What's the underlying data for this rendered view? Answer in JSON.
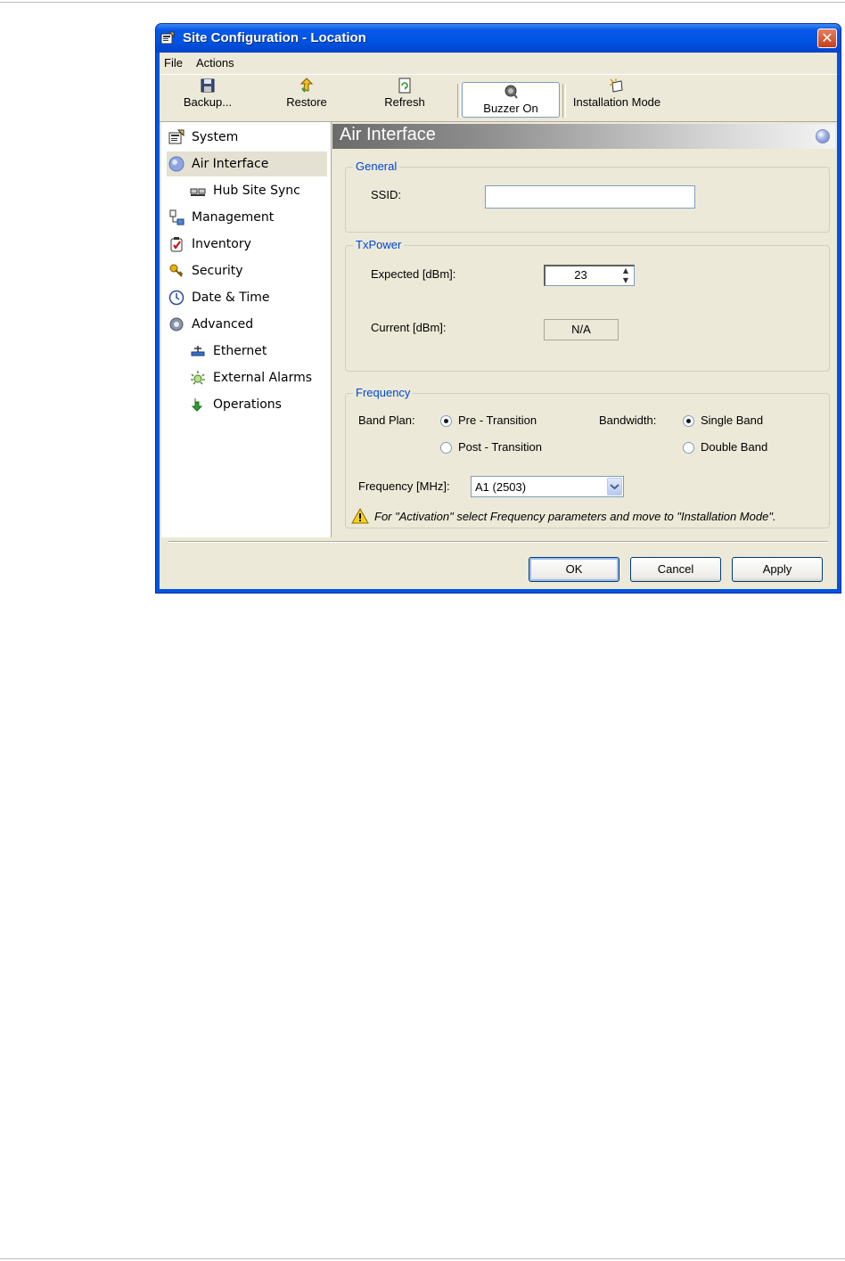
{
  "window": {
    "title": "Site Configuration - Location",
    "close": "✕"
  },
  "menu": [
    {
      "label": "File"
    },
    {
      "label": "Actions"
    }
  ],
  "toolbar": [
    {
      "label": "Backup...",
      "icon": "floppy-disk-icon"
    },
    {
      "label": "Restore",
      "icon": "restore-arrow-icon"
    },
    {
      "label": "Refresh",
      "icon": "refresh-icon"
    },
    {
      "label": "Buzzer On",
      "icon": "buzzer-icon",
      "pressed": true
    },
    {
      "label": "Installation Mode",
      "icon": "installation-mode-icon"
    }
  ],
  "nav": [
    {
      "label": "System",
      "icon": "system-icon",
      "level": 0
    },
    {
      "label": "Air Interface",
      "icon": "air-interface-icon",
      "level": 0,
      "selected": true
    },
    {
      "label": "Hub Site Sync",
      "icon": "hub-site-sync-icon",
      "level": 1
    },
    {
      "label": "Management",
      "icon": "management-icon",
      "level": 0
    },
    {
      "label": "Inventory",
      "icon": "inventory-icon",
      "level": 0
    },
    {
      "label": "Security",
      "icon": "security-key-icon",
      "level": 0
    },
    {
      "label": "Date & Time",
      "icon": "clock-icon",
      "level": 0
    },
    {
      "label": "Advanced",
      "icon": "gear-icon",
      "level": 0
    },
    {
      "label": "Ethernet",
      "icon": "ethernet-icon",
      "level": 1
    },
    {
      "label": "External Alarms",
      "icon": "alarm-icon",
      "level": 1
    },
    {
      "label": "Operations",
      "icon": "operations-arrow-icon",
      "level": 1
    }
  ],
  "panel": {
    "title": "Air Interface",
    "general": {
      "label": "General",
      "ssid_label": "SSID:",
      "ssid_value": ""
    },
    "txpower": {
      "label": "TxPower",
      "expected_label": "Expected [dBm]:",
      "expected_value": "23",
      "current_label": "Current [dBm]:",
      "current_value": "N/A"
    },
    "frequency": {
      "label": "Frequency",
      "band_plan_label": "Band Plan:",
      "band_plan_options": [
        {
          "label": "Pre - Transition",
          "checked": true
        },
        {
          "label": "Post - Transition",
          "checked": false
        }
      ],
      "bandwidth_label": "Bandwidth:",
      "bandwidth_options": [
        {
          "label": "Single Band",
          "checked": true
        },
        {
          "label": "Double Band",
          "checked": false
        }
      ],
      "freq_label": "Frequency [MHz]:",
      "freq_value": "A1 (2503)",
      "warning": "For \"Activation\" select Frequency parameters and move to \"Installation Mode\"."
    }
  },
  "buttons": {
    "ok": "OK",
    "cancel": "Cancel",
    "apply": "Apply"
  }
}
